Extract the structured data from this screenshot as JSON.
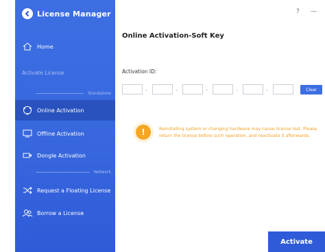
{
  "app": {
    "title": "License Manager"
  },
  "window": {
    "help": "?",
    "minimize": "—"
  },
  "sidebar": {
    "home": "Home",
    "section": "Activate License",
    "standalone": "Standalone",
    "items": [
      {
        "label": "Online Activation",
        "icon": "globe-icon"
      },
      {
        "label": "Offline Activation",
        "icon": "monitor-icon"
      },
      {
        "label": "Dongle Activation",
        "icon": "dongle-icon"
      }
    ],
    "network": "Network",
    "network_items": [
      {
        "label": "Request a Floating License",
        "icon": "shuffle-icon"
      },
      {
        "label": "Borrow a License",
        "icon": "users-icon"
      }
    ]
  },
  "main": {
    "title": "Online Activation-Soft Key",
    "activation_label": "Activation ID:",
    "key_fields": [
      "",
      "",
      "",
      "",
      "",
      ""
    ],
    "clear": "Clear",
    "warning": "Reinstalling system or changing hardware may cause license lost. Please return the license before such operation, and reactivate it afterwards.",
    "activate": "Activate"
  },
  "colors": {
    "primary": "#3d6fe3",
    "active": "#2a52bf",
    "warning": "#f5a623"
  }
}
